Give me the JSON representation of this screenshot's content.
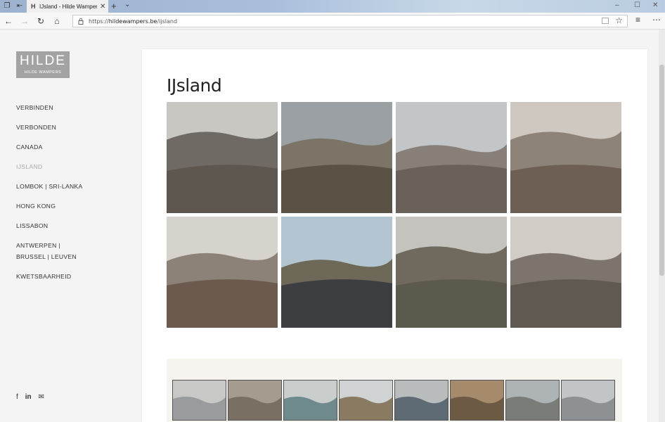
{
  "browser": {
    "tab_title": "IJsland - Hilde Wampers",
    "tab_favicon": "H",
    "url_scheme": "https://",
    "url_host": "hildewampers.be",
    "url_path": "/ijsland"
  },
  "site": {
    "logo_main": "HILDE",
    "logo_sub": "HILDE WAMPERS",
    "menu": [
      {
        "label": "VERBINDEN",
        "active": false
      },
      {
        "label": "VERBONDEN",
        "active": false
      },
      {
        "label": "CANADA",
        "active": false
      },
      {
        "label": "IJSLAND",
        "active": true
      },
      {
        "label": "LOMBOK | SRI-LANKA",
        "active": false
      },
      {
        "label": "HONG KONG",
        "active": false
      },
      {
        "label": "LISSABON",
        "active": false
      },
      {
        "label": "ANTWERPEN | BRUSSEL | LEUVEN",
        "active": false
      },
      {
        "label": "KWETSBAARHEID",
        "active": false
      }
    ],
    "social_icons": [
      "facebook-icon",
      "linkedin-icon",
      "mail-icon"
    ]
  },
  "gallery": {
    "title": "IJsland",
    "photos": [
      {
        "sky": "#c9c7c1",
        "hill": "#6f6a63",
        "ground": "#5e574f"
      },
      {
        "sky": "#9aa0a4",
        "hill": "#7c7467",
        "ground": "#5b5246"
      },
      {
        "sky": "#c2c6c9",
        "hill": "#888078",
        "ground": "#6a625a"
      },
      {
        "sky": "#cfc8c0",
        "hill": "#8e8379",
        "ground": "#6e5f55"
      },
      {
        "sky": "#d6d2cc",
        "hill": "#8d8278",
        "ground": "#6c5a4f"
      },
      {
        "sky": "#b4c5d2",
        "hill": "#6d6858",
        "ground": "#3d3e42"
      },
      {
        "sky": "#c4c3bd",
        "hill": "#6f6a5d",
        "ground": "#5c5a4c"
      },
      {
        "sky": "#d1ccc5",
        "hill": "#7d746d",
        "ground": "#5f5952"
      }
    ],
    "thumbs": [
      {
        "a": "#9a9b9c",
        "b": "#c8c8c6"
      },
      {
        "a": "#7a6f63",
        "b": "#a59b8e"
      },
      {
        "a": "#6f8a8c",
        "b": "#c9cdcb"
      },
      {
        "a": "#8b7a62",
        "b": "#cfd3d4"
      },
      {
        "a": "#5f6b74",
        "b": "#b9bcbd"
      },
      {
        "a": "#6d5a45",
        "b": "#a58b6c"
      },
      {
        "a": "#7a7c78",
        "b": "#aeb3b6"
      },
      {
        "a": "#8d9194",
        "b": "#c2c5c7"
      }
    ]
  }
}
